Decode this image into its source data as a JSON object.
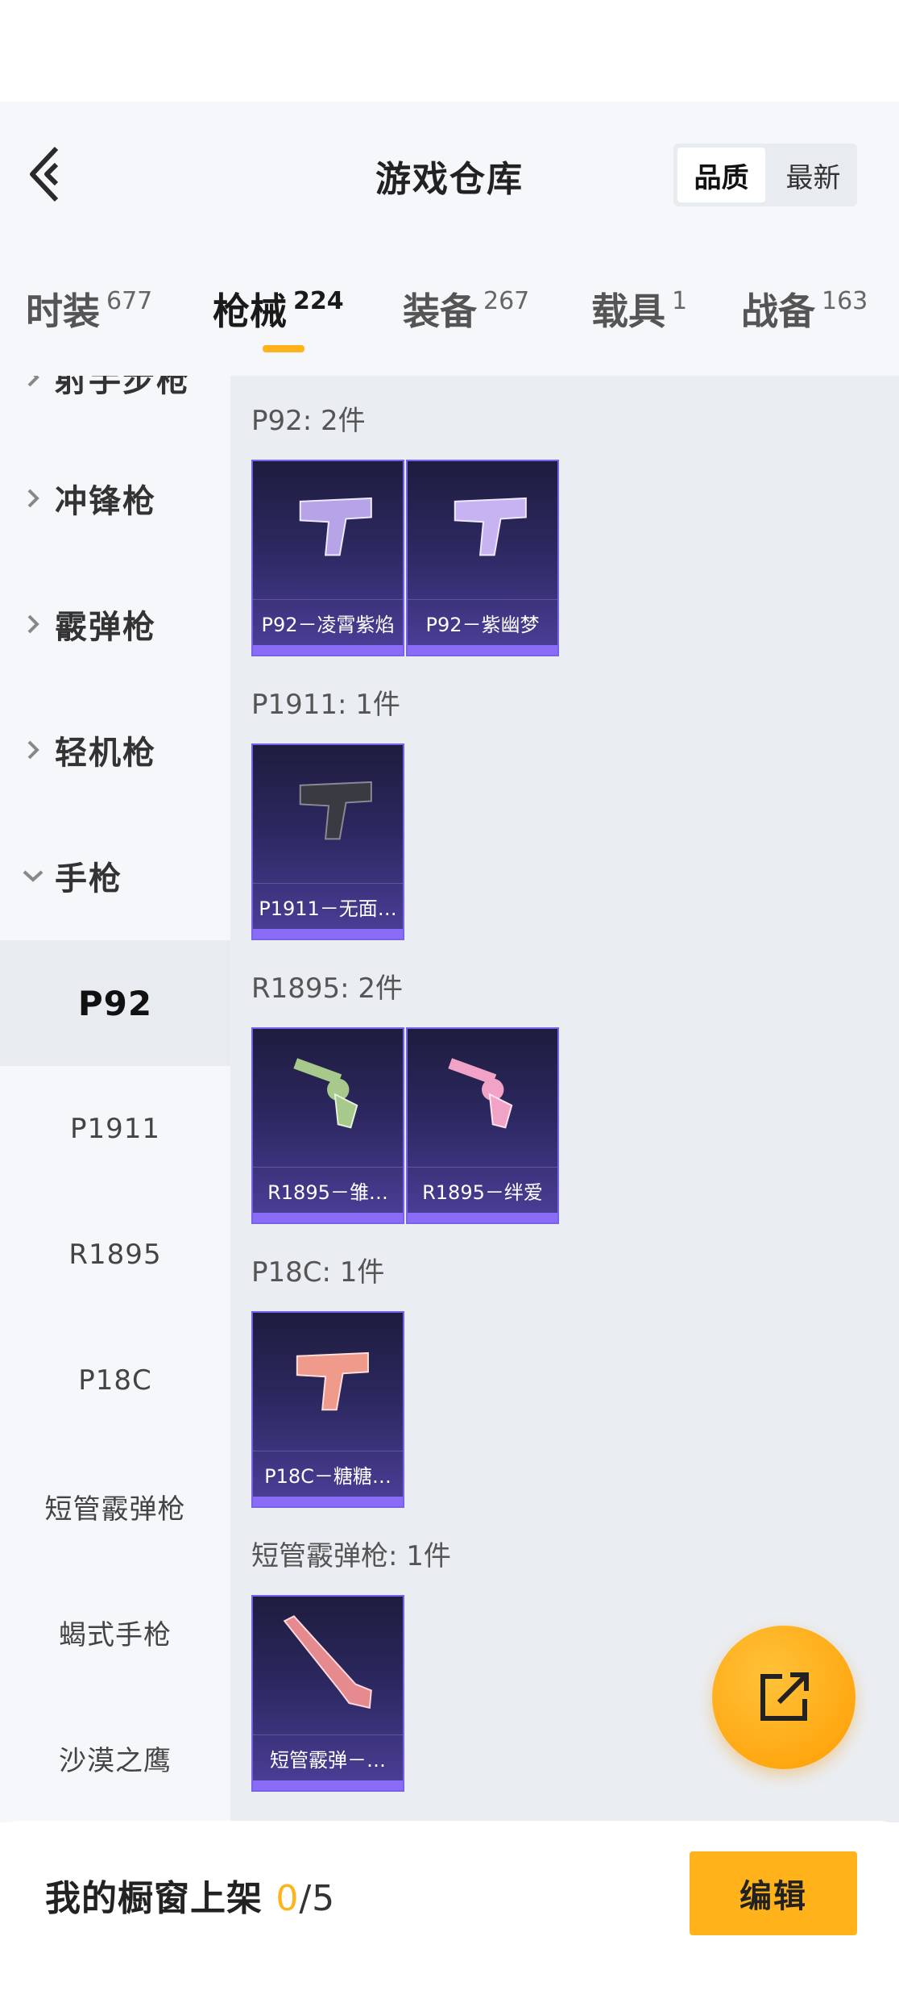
{
  "header": {
    "title": "游戏仓库",
    "sort": [
      {
        "label": "品质",
        "active": true
      },
      {
        "label": "最新",
        "active": false
      }
    ]
  },
  "tabs": [
    {
      "label": "时装",
      "count": "677"
    },
    {
      "label": "枪械",
      "count": "224",
      "active": true
    },
    {
      "label": "装备",
      "count": "267"
    },
    {
      "label": "载具",
      "count": "1"
    },
    {
      "label": "战备",
      "count": "163"
    }
  ],
  "sidebar": {
    "categories": [
      {
        "label": "射手步枪",
        "expanded": false
      },
      {
        "label": "冲锋枪",
        "expanded": false
      },
      {
        "label": "霰弹枪",
        "expanded": false
      },
      {
        "label": "轻机枪",
        "expanded": false
      },
      {
        "label": "手枪",
        "expanded": true
      }
    ],
    "subcategories": [
      {
        "label": "P92",
        "active": true
      },
      {
        "label": "P1911"
      },
      {
        "label": "R1895"
      },
      {
        "label": "P18C"
      },
      {
        "label": "短管霰弹枪"
      },
      {
        "label": "蝎式手枪"
      },
      {
        "label": "沙漠之鹰"
      }
    ]
  },
  "groups": [
    {
      "title": "P92: 2件",
      "items": [
        {
          "name": "P92－凌霄紫焰",
          "icon": "pistol-lavender-icon",
          "color": "#b7a4e8"
        },
        {
          "name": "P92－紫幽梦",
          "icon": "pistol-lilac-icon",
          "color": "#c7b3f2"
        }
      ]
    },
    {
      "title": "P1911: 1件",
      "items": [
        {
          "name": "P1911－无面…",
          "icon": "pistol-black-icon",
          "color": "#3a3a42"
        }
      ]
    },
    {
      "title": "R1895: 2件",
      "items": [
        {
          "name": "R1895－雏…",
          "icon": "revolver-green-icon",
          "color": "#a7c98b"
        },
        {
          "name": "R1895－绊爱",
          "icon": "revolver-pink-icon",
          "color": "#f0a3c6"
        }
      ]
    },
    {
      "title": "P18C: 1件",
      "items": [
        {
          "name": "P18C－糖糖…",
          "icon": "pistol-coral-icon",
          "color": "#f09a8c"
        }
      ]
    },
    {
      "title": "短管霰弹枪: 1件",
      "items": [
        {
          "name": "短管霰弹－…",
          "icon": "shotgun-pink-icon",
          "color": "#e58a8f"
        }
      ]
    }
  ],
  "colors": {
    "accent": "#ffb21a",
    "card_border": "#7562ea"
  },
  "fab": {
    "icon": "share-external-icon"
  },
  "bottom": {
    "label": "我的橱窗上架 ",
    "count": "0",
    "total": "/5",
    "edit_label": "编辑"
  }
}
